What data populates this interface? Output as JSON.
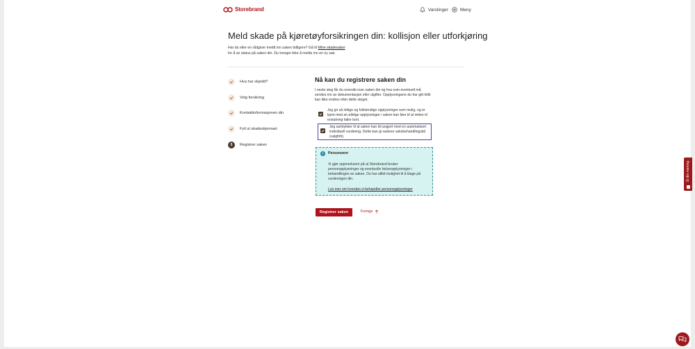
{
  "header": {
    "brand": "Storebrand",
    "notifications_label": "Varslinger",
    "menu_label": "Meny"
  },
  "page": {
    "title": "Meld skade på kjøretøyforsikringen din: kollisjon eller utforkjøring",
    "intro_before": "Har du eller en rådgiver meldt inn saken tidligere? Gå til ",
    "intro_link": "Mine skadesaker",
    "intro_after": " for å se status på saken din. Du trenger ikke å melde inn en ny sak."
  },
  "steps": [
    {
      "label": "Hva har skjedd?",
      "status": "done"
    },
    {
      "label": "Velg forsikring",
      "status": "done"
    },
    {
      "label": "Kontaktinformasjonen din",
      "status": "done"
    },
    {
      "label": "Fyll ut skadeskjemaet",
      "status": "done"
    },
    {
      "label": "Registrer saken",
      "status": "current",
      "number": "5"
    }
  ],
  "form": {
    "title": "Nå kan du registrere saken din",
    "description": "I neste steg får du oversikt over saken din og hva som eventuelt må sendes inn av dokumentasjon eller utgifter. Opplysningene du har gitt hittil kan ikke endres etter dette steget.",
    "checkboxes": [
      {
        "label": "Jeg gir så riktige og fullstendige opplysninger som mulig, og er kjent med at uriktige opplysninger i saken kan føre til at retten til erstatning faller bort.",
        "checked": true
      },
      {
        "label": "Jeg samtykker til at saken kan bli avgjort med en automatisert individuell vurdering. Dette kan gi raskere saksbehandlingstid (valgfritt).",
        "checked": true
      }
    ],
    "privacy": {
      "title": "Personvern",
      "text": "Vi gjør oppmerksom på at Storebrand bruker personopplysninger og eventuelle helseopplysninger i behandlingen av saken. Du har alltid mulighet til å klage på vurderingen din.",
      "link": "Les mer om hvordan vi behandler personopplysninger"
    },
    "submit_label": "Registrer saken",
    "previous_label": "Forrige"
  },
  "feedback_label": "Si din mening",
  "colors": {
    "brand_red": "#b0121b",
    "step_done_bg": "#f5e9dc",
    "step_current_bg": "#4a3a30",
    "privacy_bg": "#d6f2f1",
    "privacy_border": "#2a8f8c"
  }
}
